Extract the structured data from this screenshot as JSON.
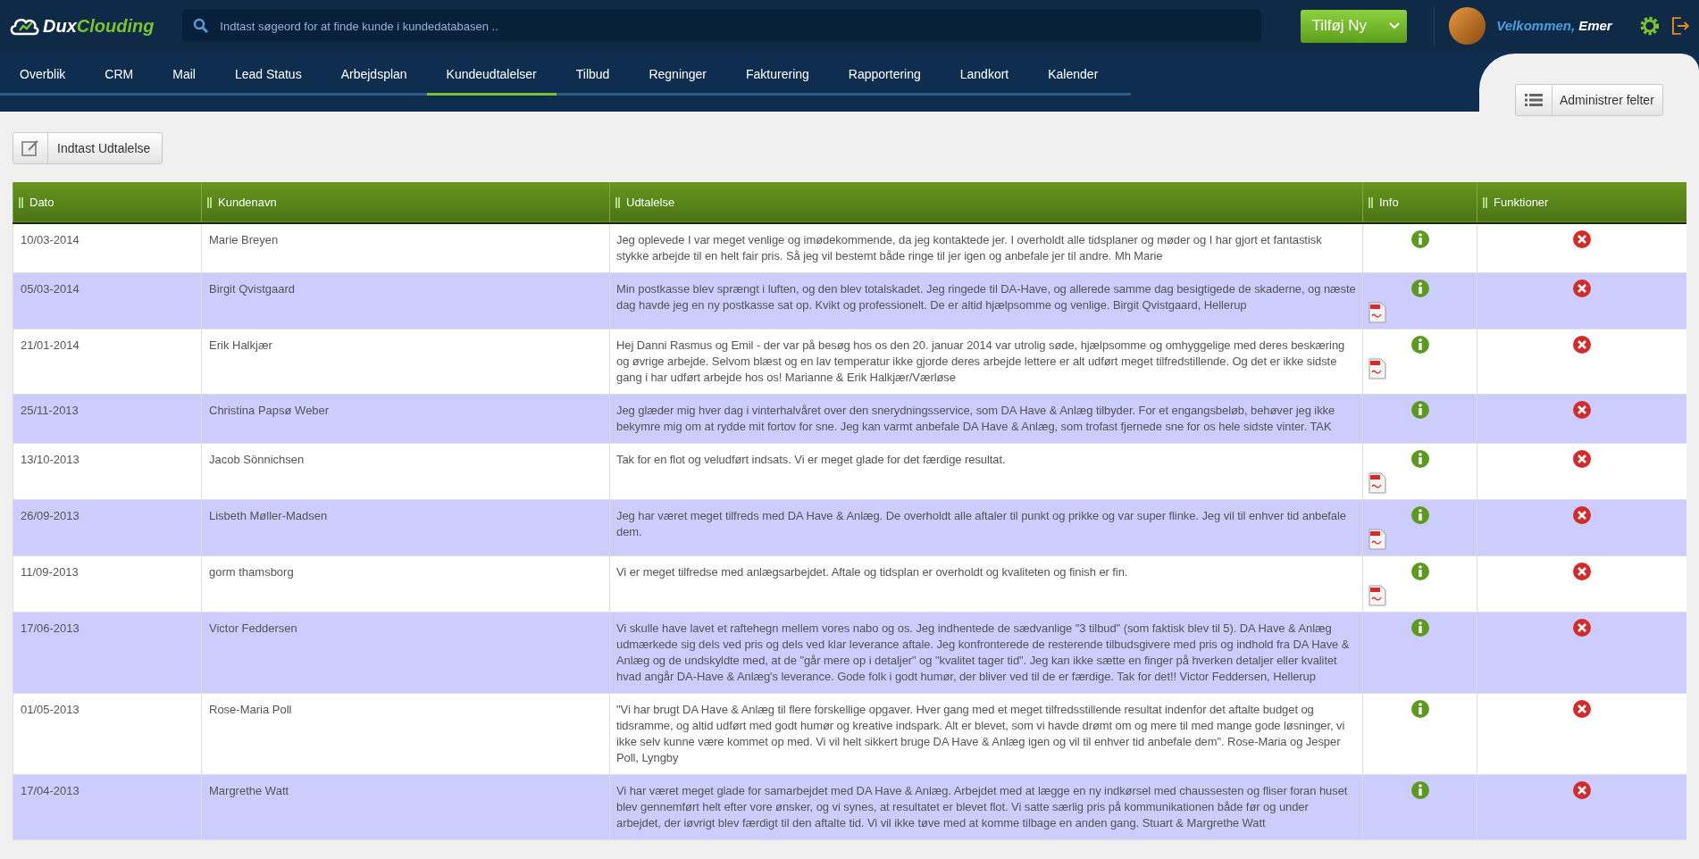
{
  "header": {
    "logo": {
      "first": "Dux",
      "second": "Clouding"
    },
    "search": {
      "placeholder": "Indtast søgeord for at finde kunde i kundedatabasen .."
    },
    "add_button": "Tilføj Ny",
    "greeting": "Velkommen,",
    "user_name": "Emer"
  },
  "nav": [
    {
      "label": "Overblik",
      "selected": false
    },
    {
      "label": "CRM",
      "selected": false
    },
    {
      "label": "Mail",
      "selected": false
    },
    {
      "label": "Lead Status",
      "selected": false
    },
    {
      "label": "Arbejdsplan",
      "selected": false
    },
    {
      "label": "Kundeudtalelser",
      "selected": true
    },
    {
      "label": "Tilbud",
      "selected": false
    },
    {
      "label": "Regninger",
      "selected": false
    },
    {
      "label": "Fakturering",
      "selected": false
    },
    {
      "label": "Rapportering",
      "selected": false
    },
    {
      "label": "Landkort",
      "selected": false
    },
    {
      "label": "Kalender",
      "selected": false
    }
  ],
  "manage_fields_button": "Administrer felter",
  "new_statement_button": "Indtast Udtalelse",
  "table": {
    "columns": [
      "Dato",
      "Kundenavn",
      "Udtalelse",
      "Info",
      "Funktioner"
    ],
    "rows": [
      {
        "date": "10/03-2014",
        "name": "Marie Breyen",
        "statement": "Jeg oplevede I var meget venlige og imødekommende, da jeg kontaktede jer. I overholdt alle tidsplaner og møder og I har gjort et fantastisk stykke arbejde til en helt fair pris. Så jeg vil bestemt både ringe til jer igen og anbefale jer til andre. Mh Marie",
        "has_pdf": false
      },
      {
        "date": "05/03-2014",
        "name": "Birgit Qvistgaard",
        "statement": "Min postkasse blev sprængt i luften, og den blev totalskadet. Jeg ringede til DA-Have, og allerede samme dag besigtigede de skaderne, og næste dag havde jeg en ny postkasse sat op. Kvikt og professionelt. De er altid hjælpsomme og venlige. Birgit Qvistgaard, Hellerup",
        "has_pdf": true
      },
      {
        "date": "21/01-2014",
        "name": "Erik Halkjær",
        "statement": "Hej Danni Rasmus og Emil - der var på besøg hos os den 20. januar 2014 var utrolig søde, hjælpsomme og omhyggelige med deres beskæring og øvrige arbejde. Selvom blæst og en lav temperatur ikke gjorde deres arbejde lettere er alt udført meget tilfredstillende. Og det er ikke sidste gang i har udført arbejde hos os! Marianne & Erik Halkjær/Værløse",
        "has_pdf": true
      },
      {
        "date": "25/11-2013",
        "name": "Christina Papsø Weber",
        "statement": "Jeg glæder mig hver dag i vinterhalvåret over den snerydningsservice, som DA Have & Anlæg tilbyder. For et engangsbeløb, behøver jeg ikke bekymre mig om at rydde mit fortov for sne. Jeg kan varmt anbefale DA Have & Anlæg, som trofast fjernede sne for os hele sidste vinter. TAK",
        "has_pdf": false
      },
      {
        "date": "13/10-2013",
        "name": "Jacob Sönnichsen",
        "statement": "Tak for en flot og veludført indsats. Vi er meget glade for det færdige resultat.",
        "has_pdf": true
      },
      {
        "date": "26/09-2013",
        "name": "Lisbeth Møller-Madsen",
        "statement": "Jeg har været meget tilfreds med DA Have & Anlæg. De overholdt alle aftaler til punkt og prikke og var super flinke. Jeg vil til enhver tid anbefale dem.",
        "has_pdf": true
      },
      {
        "date": "11/09-2013",
        "name": "gorm thamsborg",
        "statement": "Vi er meget tilfredse med anlægsarbejdet. Aftale og tidsplan er overholdt og kvaliteten og finish er fin.",
        "has_pdf": true
      },
      {
        "date": "17/06-2013",
        "name": "Victor Feddersen",
        "statement": "Vi skulle have lavet et raftehegn mellem vores nabo og os. Jeg indhentede de sædvanlige \"3 tilbud\" (som faktisk blev til 5). DA Have & Anlæg udmærkede sig dels ved pris og dels ved klar leverance aftale. Jeg konfronterede de resterende tilbudsgivere med pris og indhold fra DA Have & Anlæg og de undskyldte med, at de \"går mere op i detaljer\" og \"kvalitet tager tid\". Jeg kan ikke sætte en finger på hverken detaljer eller kvalitet hvad angår DA-Have & Anlæg's leverance. Gode folk i godt humør, der bliver ved til de er færdige. Tak for det!! Victor Feddersen, Hellerup",
        "has_pdf": false
      },
      {
        "date": "01/05-2013",
        "name": "Rose-Maria Poll",
        "statement": "\"Vi har brugt DA Have & Anlæg til flere forskellige opgaver. Hver gang med et meget tilfredsstillende resultat indenfor det aftalte budget og tidsramme, og altid udført med godt humør og kreative indspark. Alt er blevet, som vi havde drømt om og mere til med mange gode løsninger, vi ikke selv kunne være kommet op med. Vi vil helt sikkert bruge DA Have & Anlæg igen og vil til enhver tid anbefale dem\". Rose-Maria og Jesper Poll, Lyngby",
        "has_pdf": false
      },
      {
        "date": "17/04-2013",
        "name": "Margrethe Watt",
        "statement": "Vi har været meget glade for samarbejdet med DA Have & Anlæg. Arbejdet med at lægge en ny indkørsel med chaussesten og fliser foran huset blev gennemført helt efter vore ønsker, og vi synes, at resultatet er blevet flot. Vi satte særlig pris på kommunikationen både før og under arbejdet, der iøvrigt blev færdigt til den aftalte tid. Vi vil ikke tøve med at komme tilbage en anden gang. Stuart & Margrethe Watt",
        "has_pdf": false
      }
    ]
  }
}
